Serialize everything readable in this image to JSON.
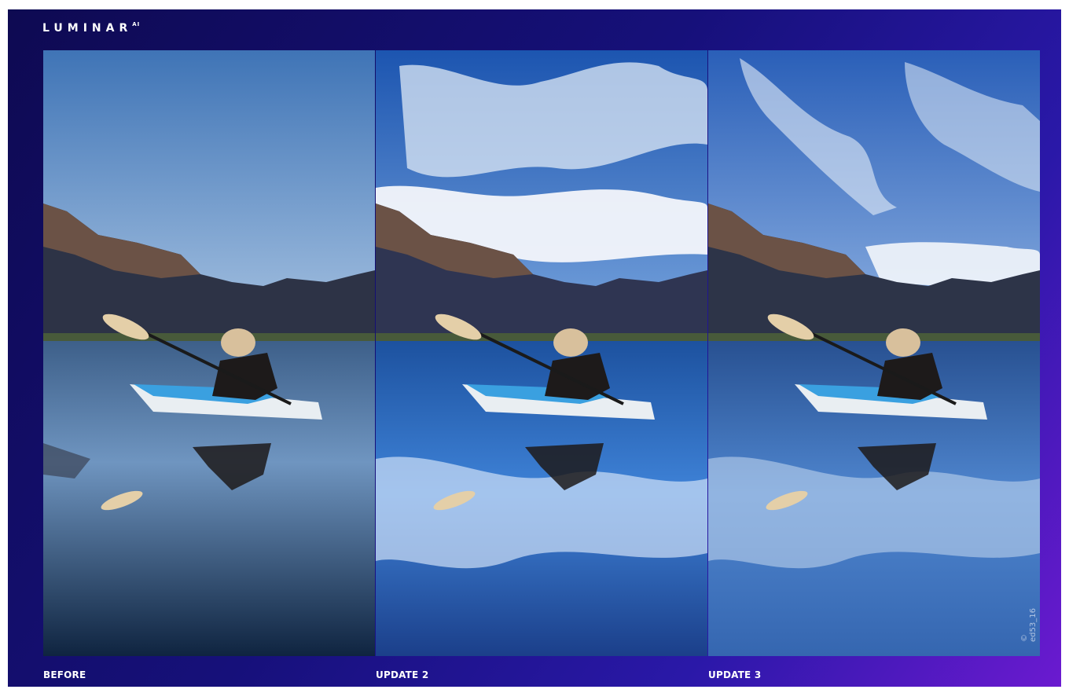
{
  "app": {
    "brand": "LUMINAR",
    "brand_suffix": "AI"
  },
  "panels": [
    {
      "caption": "BEFORE",
      "sky": "plain-blue"
    },
    {
      "caption": "UPDATE 2",
      "sky": "dramatic-clouds"
    },
    {
      "caption": "UPDATE 3",
      "sky": "wispy-clouds"
    }
  ],
  "credit": "© ed53_16",
  "colors": {
    "background_start": "#0e0a52",
    "background_end": "#6b1ad0",
    "sky_plain": "#5c8cc4",
    "sky_deep": "#1f5fb8",
    "mountain": "#2f3348",
    "kayak": "#e9eef2",
    "kayak_accent": "#3aa0e0"
  }
}
